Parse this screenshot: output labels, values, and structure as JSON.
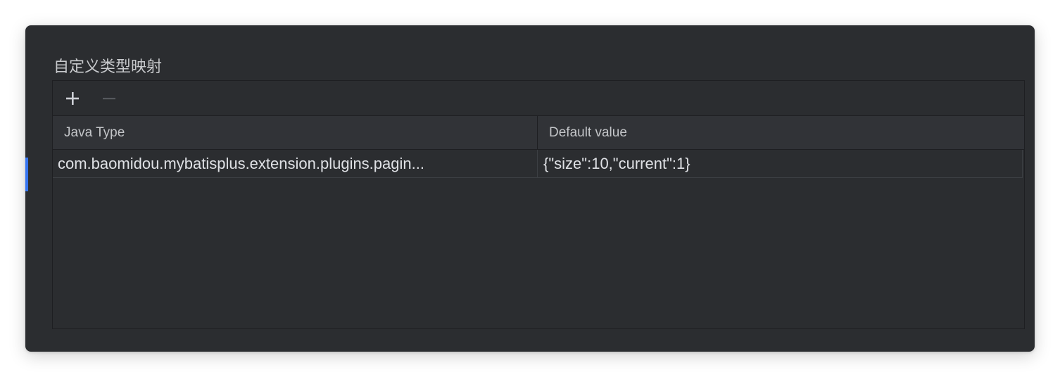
{
  "section": {
    "title": "自定义类型映射"
  },
  "toolbar": {
    "add_icon": "plus-icon",
    "remove_icon": "minus-icon"
  },
  "table": {
    "columns": [
      "Java Type",
      "Default value"
    ],
    "rows": [
      [
        "com.baomidou.mybatisplus.extension.plugins.pagin...",
        "{\"size\":10,\"current\":1}"
      ]
    ]
  },
  "colors": {
    "panel_bg": "#2b2d30",
    "header_bg": "#313337",
    "focus_accent": "#3574f0",
    "text": "#dfe1e5"
  }
}
